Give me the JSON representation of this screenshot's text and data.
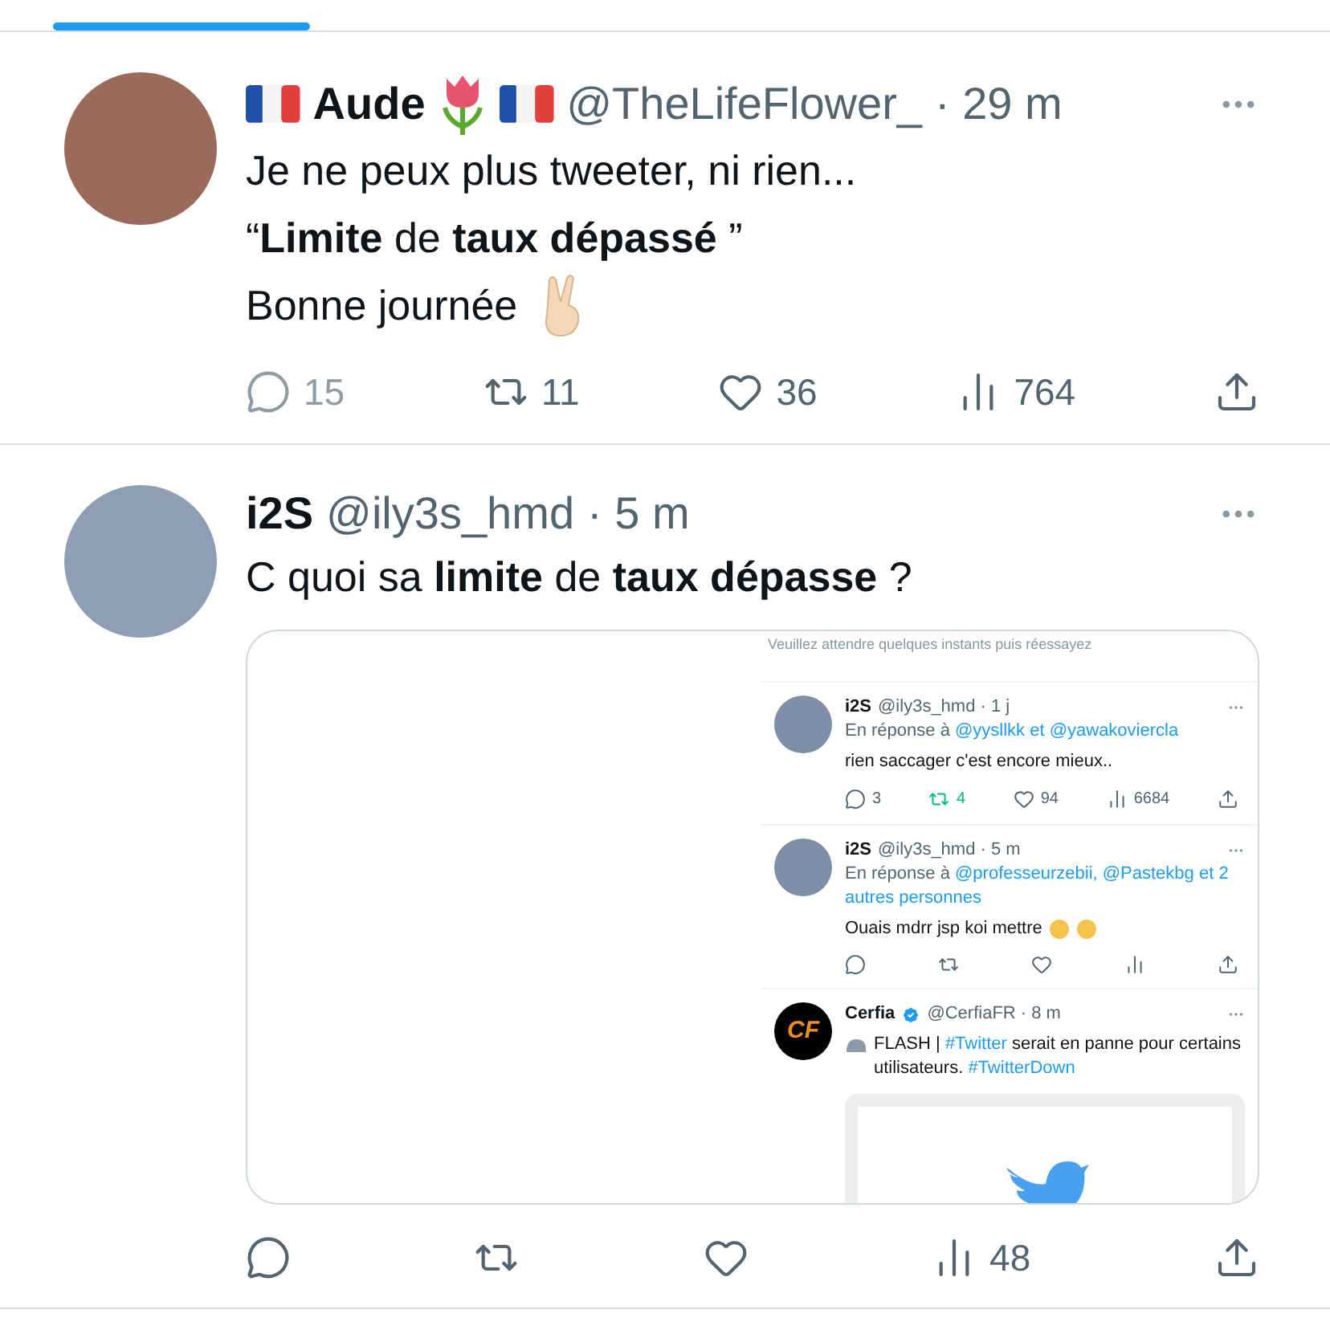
{
  "tweets": [
    {
      "name": "Aude",
      "handle": "@TheLifeFlower_",
      "time": "· 29 m",
      "lines": [
        "Je ne peux plus tweeter, ni rien...",
        "“**Limite** de **taux dépassé** ”",
        "Bonne journée"
      ],
      "actions": [
        {
          "kind": "reply",
          "count": "15",
          "disabled": true
        },
        {
          "kind": "retweet",
          "count": "11",
          "disabled": false
        },
        {
          "kind": "like",
          "count": "36",
          "disabled": false
        },
        {
          "kind": "views",
          "count": "764",
          "disabled": false
        },
        {
          "kind": "share",
          "disabled": false
        }
      ]
    },
    {
      "name": "i2S",
      "handle": "@ily3s_hmd",
      "time": "· 5 m",
      "lines": [
        "C quoi sa **limite** de **taux dépasse** ?"
      ],
      "media": {
        "notice": "Veuillez attendre quelques instants puis réessayez",
        "tweets": [
          {
            "name": "i2S",
            "verified": false,
            "handle": "@ily3s_hmd · 1 j",
            "reply_prefix": "En réponse à",
            "reply_to": "@yysllkk et @yawakoviercla",
            "body": [
              {
                "text": "rien saccager c'est encore mieux..",
                "link": false
              }
            ],
            "card": false,
            "actions": [
              {
                "kind": "reply",
                "count": "3",
                "active": false
              },
              {
                "kind": "retweet",
                "count": "4",
                "active": true
              },
              {
                "kind": "like",
                "count": "94",
                "active": false
              },
              {
                "kind": "views",
                "count": "6684",
                "active": false
              },
              {
                "kind": "share",
                "active": false
              }
            ]
          },
          {
            "name": "i2S",
            "verified": false,
            "handle": "@ily3s_hmd · 5 m",
            "reply_prefix": "En réponse à",
            "reply_to": "@professeurzebii, @Pastekbg et 2 autres personnes",
            "body": [
              {
                "text": "Ouais mdrr jsp koi mettre",
                "link": false
              }
            ],
            "card": false,
            "actions": [
              {
                "kind": "reply",
                "active": false
              },
              {
                "kind": "retweet",
                "active": false
              },
              {
                "kind": "like",
                "active": false
              },
              {
                "kind": "views",
                "active": false
              },
              {
                "kind": "share",
                "active": false
              }
            ]
          },
          {
            "logo_text": "CF",
            "name": "Cerfia",
            "verified": true,
            "handle": "@CerfiaFR · 8 m",
            "body": [
              {
                "text": "FLASH |",
                "link": false
              },
              {
                "text": "#Twitter",
                "link": true
              },
              {
                "text": "serait en panne pour certains utilisateurs.",
                "link": false
              },
              {
                "text": "#TwitterDown",
                "link": true
              }
            ],
            "card": true
          }
        ]
      },
      "actions": [
        {
          "kind": "reply",
          "disabled": false
        },
        {
          "kind": "retweet",
          "disabled": false
        },
        {
          "kind": "like",
          "disabled": false
        },
        {
          "kind": "views",
          "count": "48",
          "disabled": false
        },
        {
          "kind": "share",
          "disabled": false
        }
      ]
    }
  ]
}
